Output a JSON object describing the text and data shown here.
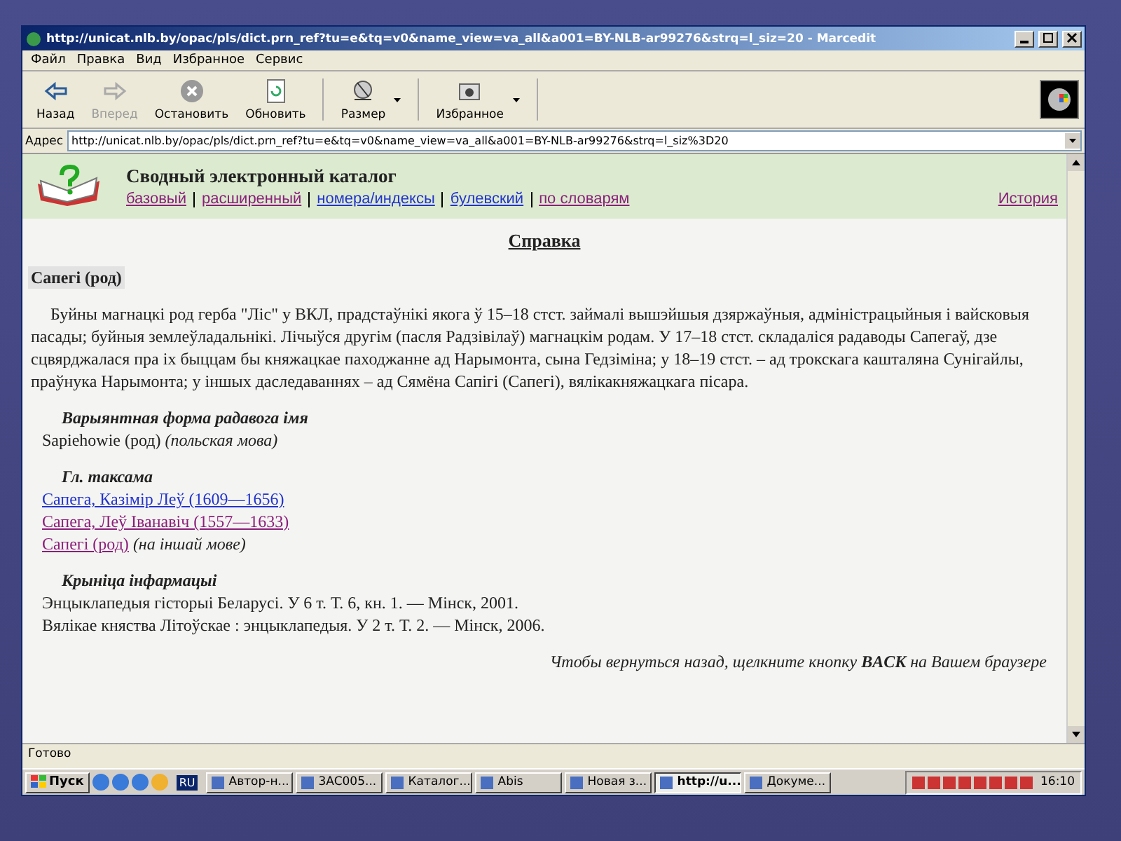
{
  "window": {
    "title": "http://unicat.nlb.by/opac/pls/dict.prn_ref?tu=e&tq=v0&name_view=va_all&a001=BY-NLB-ar99276&strq=l_siz=20 - Marcedit"
  },
  "menu": [
    "Файл",
    "Правка",
    "Вид",
    "Избранное",
    "Сервис"
  ],
  "toolbar": [
    {
      "label": "Назад",
      "kind": "back",
      "disabled": false,
      "dropdown": false
    },
    {
      "label": "Вперед",
      "kind": "forward",
      "disabled": true,
      "dropdown": false
    },
    {
      "label": "Остановить",
      "kind": "stop",
      "disabled": false,
      "dropdown": false
    },
    {
      "label": "Обновить",
      "kind": "refresh",
      "disabled": false,
      "dropdown": false
    },
    {
      "label": "Размер",
      "kind": "size",
      "disabled": false,
      "dropdown": true
    },
    {
      "label": "Избранное",
      "kind": "favorites",
      "disabled": false,
      "dropdown": true
    }
  ],
  "address": {
    "label": "Адрес",
    "value": "http://unicat.nlb.by/opac/pls/dict.prn_ref?tu=e&tq=v0&name_view=va_all&a001=BY-NLB-ar99276&strq=l_siz%3D20"
  },
  "header": {
    "title": "Сводный электронный каталог",
    "links": [
      {
        "text": "базовый",
        "visited": true
      },
      {
        "text": "расширенный",
        "visited": true
      },
      {
        "text": "номера/индексы",
        "visited": false
      },
      {
        "text": "булевский",
        "visited": false
      },
      {
        "text": "по словарям",
        "visited": true
      }
    ],
    "history": {
      "text": "История",
      "visited": true
    }
  },
  "page": {
    "heading": "Справка",
    "entry": "Сапегі (род)",
    "description": "Буйны магнацкі род герба \"Ліс\" у ВКЛ, прадстаўнікі якога ў 15–18 стст. займалі вышэйшыя дзяржаўныя, адміністрацыйныя і вайсковыя пасады; буйныя землеўладальнікі. Лічыўся другім (пасля Радзівілаў) магнацкім родам. У 17–18 стст. складаліся радаводы Сапегаў, дзе сцвярджалася пра іх быццам бы княжацкае паходжанне ад Нарымонта, сына Гедзіміна; у 18–19 стст. – ад трокскага кашталяна Сунігайлы, праўнука Нарымонта; у іншых даследаваннях – ад Сямёна Сапігі (Сапегі), вялікакняжацкага пісара.",
    "sections": [
      {
        "title": "Варыянтная форма радавога імя",
        "items": [
          {
            "kind": "text",
            "text": "Sapiehowie (род)",
            "note": "(польская мова)"
          }
        ]
      },
      {
        "title": "Гл. таксама",
        "items": [
          {
            "kind": "link",
            "text": "Сапега, Казімір Леў (1609—1656)",
            "visited": false
          },
          {
            "kind": "link",
            "text": "Сапега, Леў Іванавіч (1557—1633)",
            "visited": true
          },
          {
            "kind": "link",
            "text": "Сапегі (род)",
            "visited": true,
            "note": "(на іншай мове)"
          }
        ]
      },
      {
        "title": "Крыніца інфармацыі",
        "items": [
          {
            "kind": "text",
            "text": "Энцыклапедыя гісторыі Беларусі. У 6 т. Т. 6, кн. 1. — Мінск, 2001."
          },
          {
            "kind": "text",
            "text": "Вялікае княства Літоўскае : энцыклапедыя. У 2 т. Т. 2. — Мінск, 2006."
          }
        ]
      }
    ],
    "back_hint": "Чтобы вернуться назад, щелкните кнопку **BACK** на Вашем браузере"
  },
  "status_bar": {
    "text": "Готово"
  },
  "taskbar": {
    "start": "Пуск",
    "language": "RU",
    "tasks": [
      {
        "label": "Автор-н...",
        "selected": false
      },
      {
        "label": "3AC005...",
        "selected": false
      },
      {
        "label": "Каталог...",
        "selected": false
      },
      {
        "label": "Abis",
        "selected": false
      },
      {
        "label": "Новая з...",
        "selected": false
      },
      {
        "label": "http://u...",
        "selected": true
      },
      {
        "label": "Докуме...",
        "selected": false
      }
    ],
    "clock": "16:10"
  }
}
